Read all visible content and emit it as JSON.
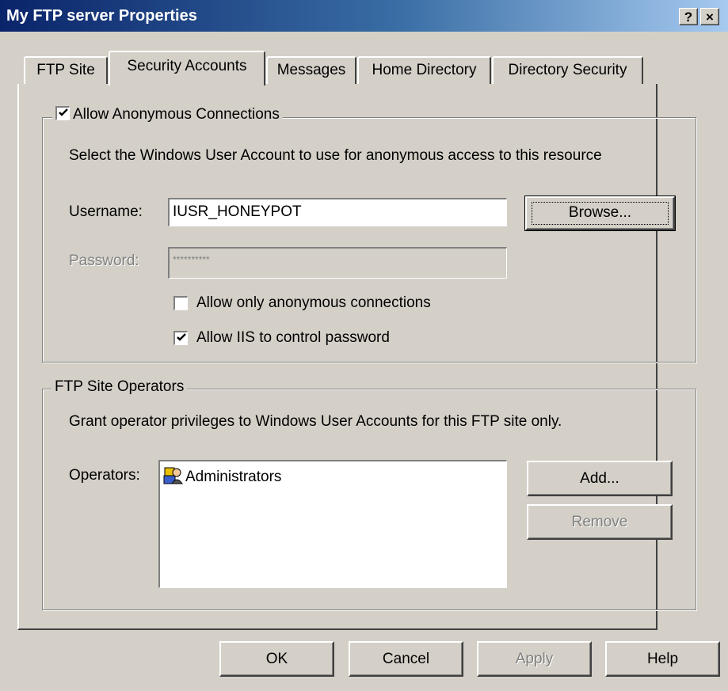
{
  "window": {
    "title": "My FTP server Properties",
    "help_button": "?",
    "close_button": "×"
  },
  "tabs": [
    {
      "label": "FTP Site",
      "active": false
    },
    {
      "label": "Security Accounts",
      "active": true
    },
    {
      "label": "Messages",
      "active": false
    },
    {
      "label": "Home Directory",
      "active": false
    },
    {
      "label": "Directory Security",
      "active": false
    }
  ],
  "anonymous": {
    "checkbox_label": "Allow Anonymous Connections",
    "checked": true,
    "description": "Select the Windows User Account to use for anonymous access to this resource",
    "username_label": "Username:",
    "username_value": "IUSR_HONEYPOT",
    "password_label": "Password:",
    "password_value": "**********",
    "browse_label": "Browse...",
    "only_anonymous_label": "Allow only anonymous connections",
    "only_anonymous_checked": false,
    "iis_control_label": "Allow IIS to control password",
    "iis_control_checked": true
  },
  "operators": {
    "group_label": "FTP Site Operators",
    "description": "Grant operator privileges to Windows User Accounts for this FTP site only.",
    "operators_label": "Operators:",
    "items": [
      "Administrators"
    ],
    "add_label": "Add...",
    "remove_label": "Remove"
  },
  "footer": {
    "ok": "OK",
    "cancel": "Cancel",
    "apply": "Apply",
    "help": "Help"
  },
  "icons": {
    "operator_item": "user-group-icon",
    "check": "checkmark-icon"
  }
}
